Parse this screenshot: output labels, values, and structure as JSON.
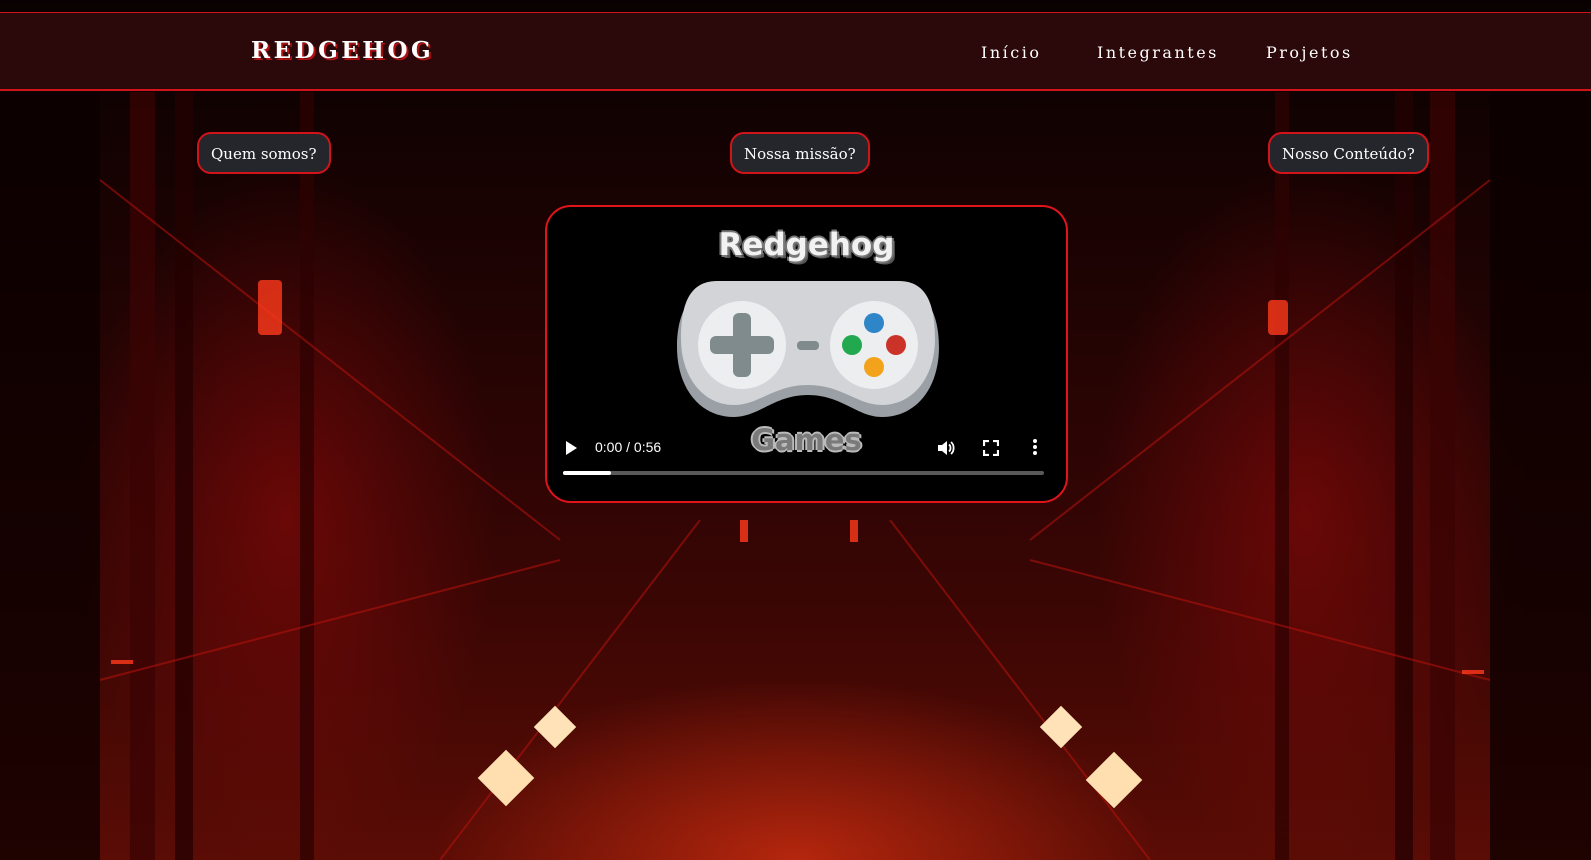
{
  "nav": {
    "brand": "REDGEHOG",
    "links": [
      "Início",
      "Integrantes",
      "Projetos"
    ]
  },
  "buttons": [
    "Quem somos?",
    "Nossa missão?",
    "Nosso Conteúdo?"
  ],
  "video": {
    "poster_title": "Redgehog",
    "poster_subtitle": "Games",
    "time": "0:00 / 0:56",
    "progress_buffered": 0.1,
    "icons": [
      "play-icon",
      "volume-icon",
      "fullscreen-icon",
      "more-options-icon"
    ]
  },
  "colors": {
    "accent": "#d0141a",
    "nav_bg": "#2d0809",
    "button_bg": "#25262b"
  }
}
